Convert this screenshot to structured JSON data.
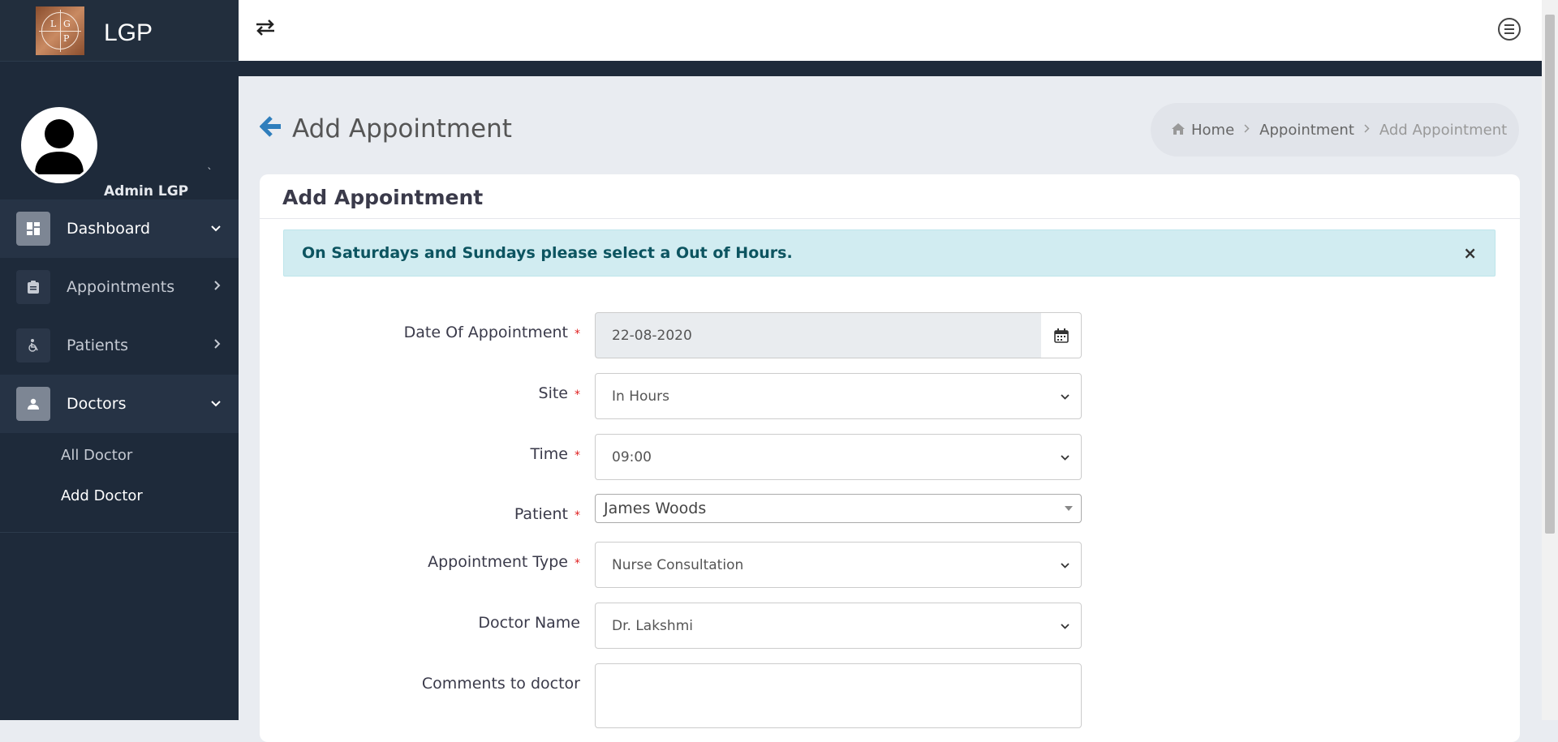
{
  "brand": {
    "name": "LGP",
    "logo_letters": [
      "L",
      "G",
      "P"
    ]
  },
  "profile": {
    "name": "Admin LGP",
    "role": "Admin",
    "mark": "`"
  },
  "sidebar": {
    "items": [
      {
        "label": "Dashboard",
        "icon": "dashboard-icon",
        "chevron": "down"
      },
      {
        "label": "Appointments",
        "icon": "clipboard-icon",
        "chevron": "right"
      },
      {
        "label": "Patients",
        "icon": "wheelchair-icon",
        "chevron": "right"
      },
      {
        "label": "Doctors",
        "icon": "user-icon",
        "chevron": "down"
      }
    ],
    "submenu": [
      {
        "label": "All Doctor"
      },
      {
        "label": "Add Doctor"
      }
    ]
  },
  "header": {
    "toggle_icon": "swap-arrows-icon",
    "menu_icon": "menu-circle-icon"
  },
  "page": {
    "title": "Add Appointment",
    "breadcrumb": [
      "Home",
      "Appointment",
      "Add Appointment"
    ]
  },
  "card": {
    "title": "Add Appointment",
    "alert": "On Saturdays and Sundays please select a Out of Hours.",
    "alert_close": "×"
  },
  "form": {
    "date_label": "Date Of Appointment",
    "date_value": "22-08-2020",
    "site_label": "Site",
    "site_value": "In Hours",
    "time_label": "Time",
    "time_value": "09:00",
    "patient_label": "Patient",
    "patient_value": "James Woods",
    "type_label": "Appointment Type",
    "type_value": "Nurse Consultation",
    "doctor_label": "Doctor Name",
    "doctor_value": "Dr. Lakshmi",
    "comments_label": "Comments to doctor",
    "comments_value": "",
    "required_mark": "*"
  },
  "colors": {
    "sidebar": "#1e2a3a",
    "accent": "#2f7ebc",
    "alert_bg": "#d1ecf1",
    "alert_text": "#0c5460"
  }
}
